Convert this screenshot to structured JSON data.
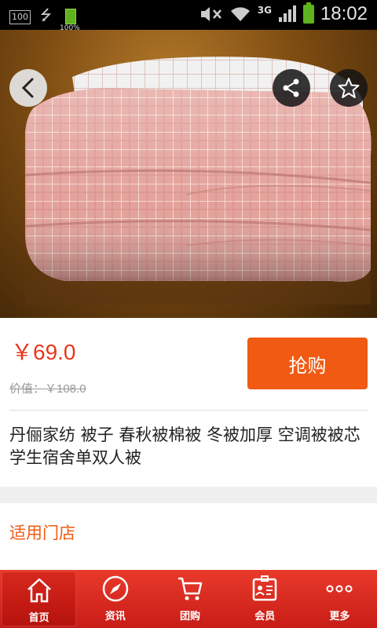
{
  "status_bar": {
    "left_box": "100",
    "battery_small_text": "100%",
    "network": "3G",
    "time": "18:02"
  },
  "hero": {
    "icons": [
      "back-icon",
      "share-icon",
      "star-icon"
    ],
    "carousel_index": 1,
    "carousel_count": 1
  },
  "product": {
    "price": "￥69.0",
    "original_price": "价值：￥108.0",
    "buy_label": "抢购",
    "title": "丹俪家纺 被子 春秋被棉被 冬被加厚 空调被被芯学生宿舍单双人被"
  },
  "store": {
    "label": "适用门店"
  },
  "tabs": [
    {
      "label": "首页",
      "icon": "home-icon"
    },
    {
      "label": "资讯",
      "icon": "compass-icon"
    },
    {
      "label": "团购",
      "icon": "cart-icon"
    },
    {
      "label": "会员",
      "icon": "member-card-icon"
    },
    {
      "label": "更多",
      "icon": "more-icon"
    }
  ],
  "colors": {
    "accent": "#f05a12",
    "price": "#e8371c",
    "tabbar": "#d8281d"
  }
}
